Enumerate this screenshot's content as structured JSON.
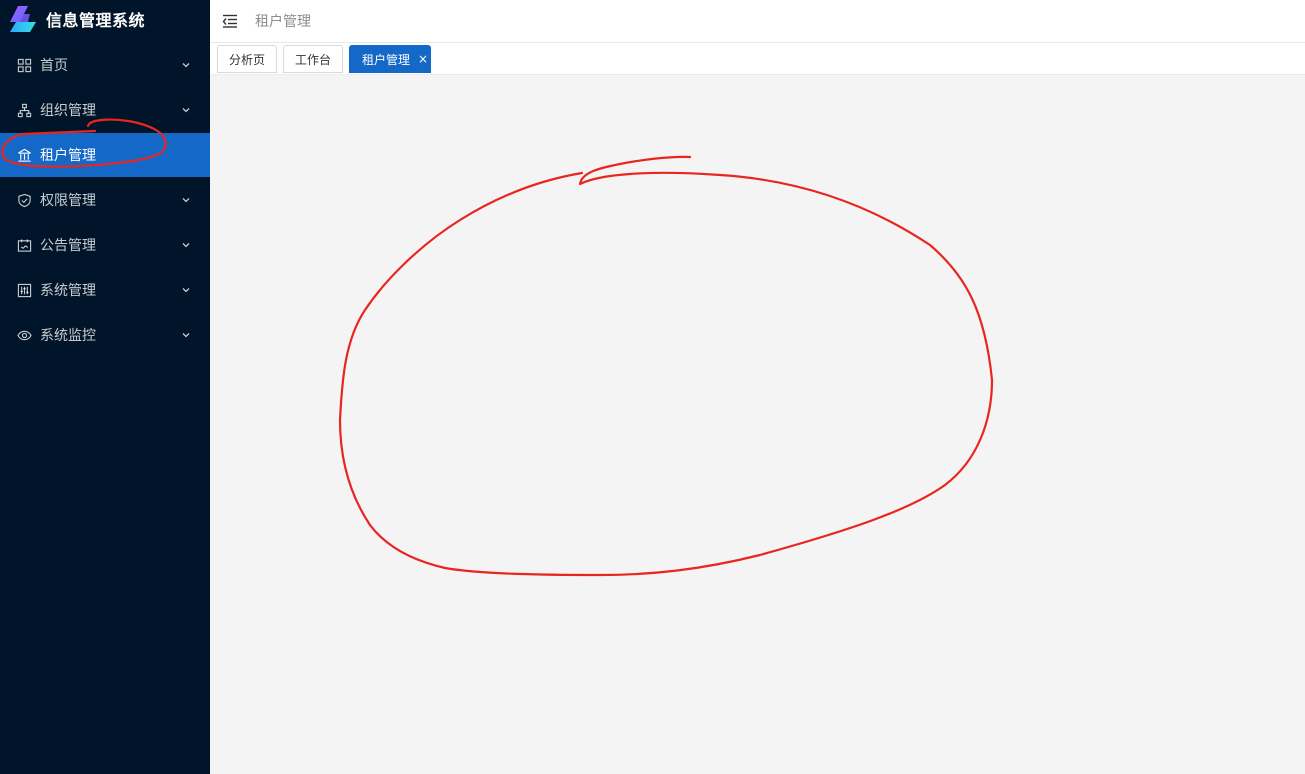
{
  "app": {
    "title": "信息管理系统"
  },
  "sidebar": {
    "items": [
      {
        "label": "首页",
        "icon": "dashboard-icon",
        "expandable": true,
        "active": false
      },
      {
        "label": "组织管理",
        "icon": "org-tree-icon",
        "expandable": true,
        "active": false
      },
      {
        "label": "租户管理",
        "icon": "bank-icon",
        "expandable": false,
        "active": true
      },
      {
        "label": "权限管理",
        "icon": "shield-check-icon",
        "expandable": true,
        "active": false
      },
      {
        "label": "公告管理",
        "icon": "calendar-icon",
        "expandable": true,
        "active": false
      },
      {
        "label": "系统管理",
        "icon": "sliders-icon",
        "expandable": true,
        "active": false
      },
      {
        "label": "系统监控",
        "icon": "eye-icon",
        "expandable": true,
        "active": false
      }
    ]
  },
  "header": {
    "breadcrumb": "租户管理"
  },
  "tabs": [
    {
      "label": "分析页",
      "active": false
    },
    {
      "label": "工作台",
      "active": false
    },
    {
      "label": "租户管理",
      "active": true,
      "close": "×"
    }
  ],
  "colors": {
    "sidebar_bg": "#001529",
    "accent": "#1468c7",
    "content_bg": "#f4f4f4",
    "annotation": "#e8261f"
  }
}
